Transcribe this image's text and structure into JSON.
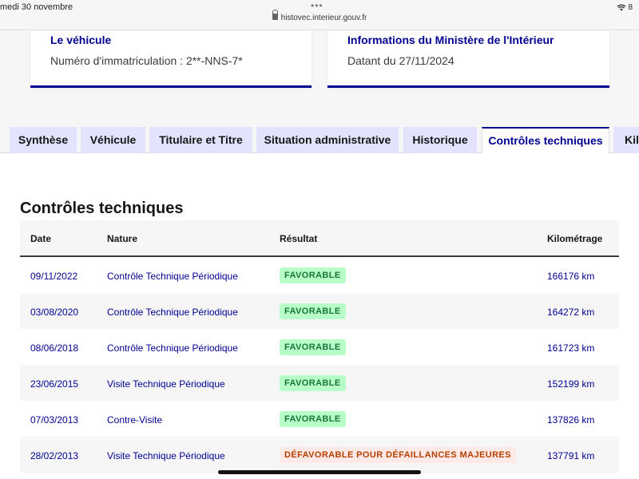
{
  "status_bar": {
    "time": "medi 30 novembre",
    "url": "histovec.interieur.gouv.fr",
    "dots": "•••",
    "wifi": "8"
  },
  "cards": {
    "vehicle": {
      "title": "Le véhicule",
      "text": "Numéro d'immatriculation : 2**-NNS-7*"
    },
    "ministry": {
      "title": "Informations du Ministère de l'Intérieur",
      "text": "Datant du 27/11/2024"
    }
  },
  "tabs": [
    {
      "label": "Synthèse"
    },
    {
      "label": "Véhicule"
    },
    {
      "label": "Titulaire et Titre"
    },
    {
      "label": "Situation administrative"
    },
    {
      "label": "Historique"
    },
    {
      "label": "Contrôles techniques"
    },
    {
      "label": "Kilo"
    }
  ],
  "section": {
    "title": "Contrôles techniques"
  },
  "table": {
    "headers": {
      "date": "Date",
      "nature": "Nature",
      "result": "Résultat",
      "km": "Kilométrage"
    },
    "rows": [
      {
        "date": "09/11/2022",
        "nature": "Contrôle Technique Périodique",
        "result": "FAVORABLE",
        "km": "166176 km"
      },
      {
        "date": "03/08/2020",
        "nature": "Contrôle Technique Périodique",
        "result": "FAVORABLE",
        "km": "164272 km"
      },
      {
        "date": "08/06/2018",
        "nature": "Contrôle Technique Périodique",
        "result": "FAVORABLE",
        "km": "161723 km"
      },
      {
        "date": "23/06/2015",
        "nature": "Visite Technique Périodique",
        "result": "FAVORABLE",
        "km": "152199 km"
      },
      {
        "date": "07/03/2013",
        "nature": "Contre-Visite",
        "result": "FAVORABLE",
        "km": "137826 km"
      },
      {
        "date": "28/02/2013",
        "nature": "Visite Technique Périodique",
        "result": "DÉFAVORABLE POUR DÉFAILLANCES MAJEURES",
        "km": "137791 km"
      }
    ]
  },
  "colors": {
    "primary": "#000091",
    "favorable_bg": "#b8fec9",
    "favorable_text": "#18753c",
    "unfavorable_bg": "#ffe9e6",
    "unfavorable_text": "#b34000"
  }
}
